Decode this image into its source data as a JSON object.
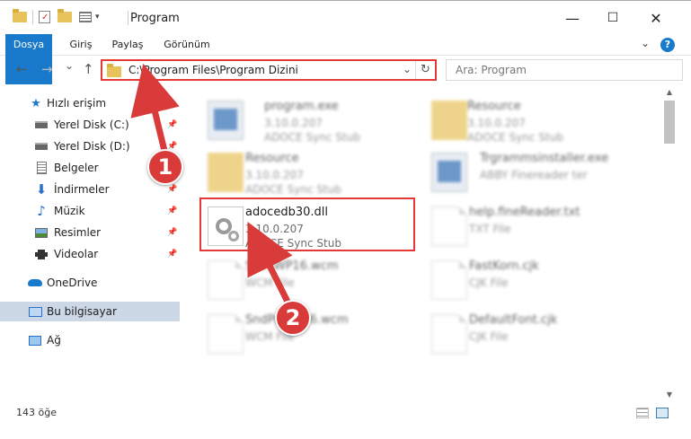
{
  "window": {
    "title": "Program",
    "minimize": "—",
    "maximize": "☐",
    "close": "✕"
  },
  "ribbon": {
    "tabs": [
      "Dosya",
      "Giriş",
      "Paylaş",
      "Görünüm"
    ],
    "help": "?"
  },
  "navigation": {
    "back": "←",
    "forward": "→",
    "recent": "⌄",
    "up": "↑",
    "address": "C:\\Program Files\\Program Dizini",
    "search_placeholder": "Ara: Program"
  },
  "sidebar": {
    "items": [
      {
        "label": "Hızlı erişim",
        "icon": "star-icon"
      },
      {
        "label": "Yerel Disk (C:)",
        "icon": "drive-icon",
        "pinned": true
      },
      {
        "label": "Yerel Disk (D:)",
        "icon": "drive-icon",
        "pinned": true
      },
      {
        "label": "Belgeler",
        "icon": "documents-icon",
        "pinned": true
      },
      {
        "label": "İndirmeler",
        "icon": "download-icon",
        "pinned": true
      },
      {
        "label": "Müzik",
        "icon": "music-icon",
        "pinned": true
      },
      {
        "label": "Resimler",
        "icon": "pictures-icon",
        "pinned": true
      },
      {
        "label": "Videolar",
        "icon": "videos-icon",
        "pinned": true
      },
      {
        "label": "OneDrive",
        "icon": "cloud-icon"
      },
      {
        "label": "Bu bilgisayar",
        "icon": "computer-icon",
        "selected": true
      },
      {
        "label": "Ağ",
        "icon": "network-icon"
      }
    ]
  },
  "files": [
    {
      "name": "program.exe",
      "line1": "3.10.0.207",
      "line2": "ADOCE Sync Stub",
      "kind": "exe"
    },
    {
      "name": "Resource",
      "line1": "3.10.0.207",
      "line2": "ADOCE Sync Stub",
      "kind": "folder"
    },
    {
      "name": "Resource",
      "line1": "3.10.0.207",
      "line2": "ADOCE Sync Stub",
      "kind": "folder"
    },
    {
      "name": "Trgrammsinstaller.exe",
      "line1": "ABBY Finereader ter",
      "line2": "",
      "kind": "exe"
    },
    {
      "name": "adocedb30.dll",
      "line1": "3.10.0.207",
      "line2": "ADOCE Sync Stub",
      "kind": "dll"
    },
    {
      "name": "help.fineReader.txt",
      "line1": "TXT File",
      "line2": "",
      "kind": "doc"
    },
    {
      "name": "ShellWP16.wcm",
      "line1": "WCM File",
      "line2": "",
      "kind": "doc"
    },
    {
      "name": "FastKorn.cjk",
      "line1": "CJK File",
      "line2": "",
      "kind": "doc"
    },
    {
      "name": "SndPrtWP16.wcm",
      "line1": "WCM File",
      "line2": "",
      "kind": "doc"
    },
    {
      "name": "DefaultFont.cjk",
      "line1": "CJK File",
      "line2": "",
      "kind": "doc"
    }
  ],
  "status": {
    "count": "143 öğe"
  },
  "annotations": {
    "step1": "1",
    "step2": "2",
    "color": "#d93a3a"
  },
  "colors": {
    "accent": "#1979ca",
    "selected": "#ccd8e5",
    "highlight_border": "#e53935"
  }
}
